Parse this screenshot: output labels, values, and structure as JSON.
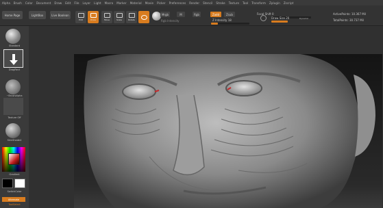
{
  "menu": [
    "Alpha",
    "Brush",
    "Color",
    "Document",
    "Draw",
    "Edit",
    "File",
    "Layer",
    "Light",
    "Macro",
    "Marker",
    "Material",
    "Movie",
    "Picker",
    "Preferences",
    "Render",
    "Stencil",
    "Stroke",
    "Texture",
    "Tool",
    "Transform",
    "Zplugin",
    "Zscript"
  ],
  "toolbar": {
    "home_page": "Home Page",
    "lightbox": "LightBox",
    "live_boolean": "Live Boolean",
    "edit": "Edit",
    "draw": "Draw",
    "move": "Move",
    "scale": "Scale",
    "rotate": "Rotate",
    "mrgb": "Mrgb",
    "rgb": "Rgb",
    "m": "M",
    "rgb_intensity": "Rgb Intensity",
    "zadd": "Zadd",
    "zsub": "Zsub",
    "z_intensity": "Z Intensity 18",
    "z_intensity_value": 18,
    "focal_shift": "Focal Shift 0",
    "focal_shift_value": 0,
    "draw_size": "Draw Size 20",
    "draw_size_value": 20,
    "dynamic": "Dynamic",
    "active_points": "ActivePoints: 10.367 Mil",
    "total_points": "TotalPoints: 30.737 Mil"
  },
  "shelf": {
    "brush": "Standard",
    "stroke": "DragRect",
    "alpha": "~BrushAlpha",
    "texture": "Texture Off",
    "material": "SkinShade4",
    "gradient": "Gradient",
    "switch_color": "SwitchColor",
    "alternate": "Alternate",
    "tool_sel": "ToolSelect"
  },
  "colors": {
    "accent": "#d87c1f",
    "background": "#2b2b2b",
    "panel": "#3a3a3a"
  }
}
